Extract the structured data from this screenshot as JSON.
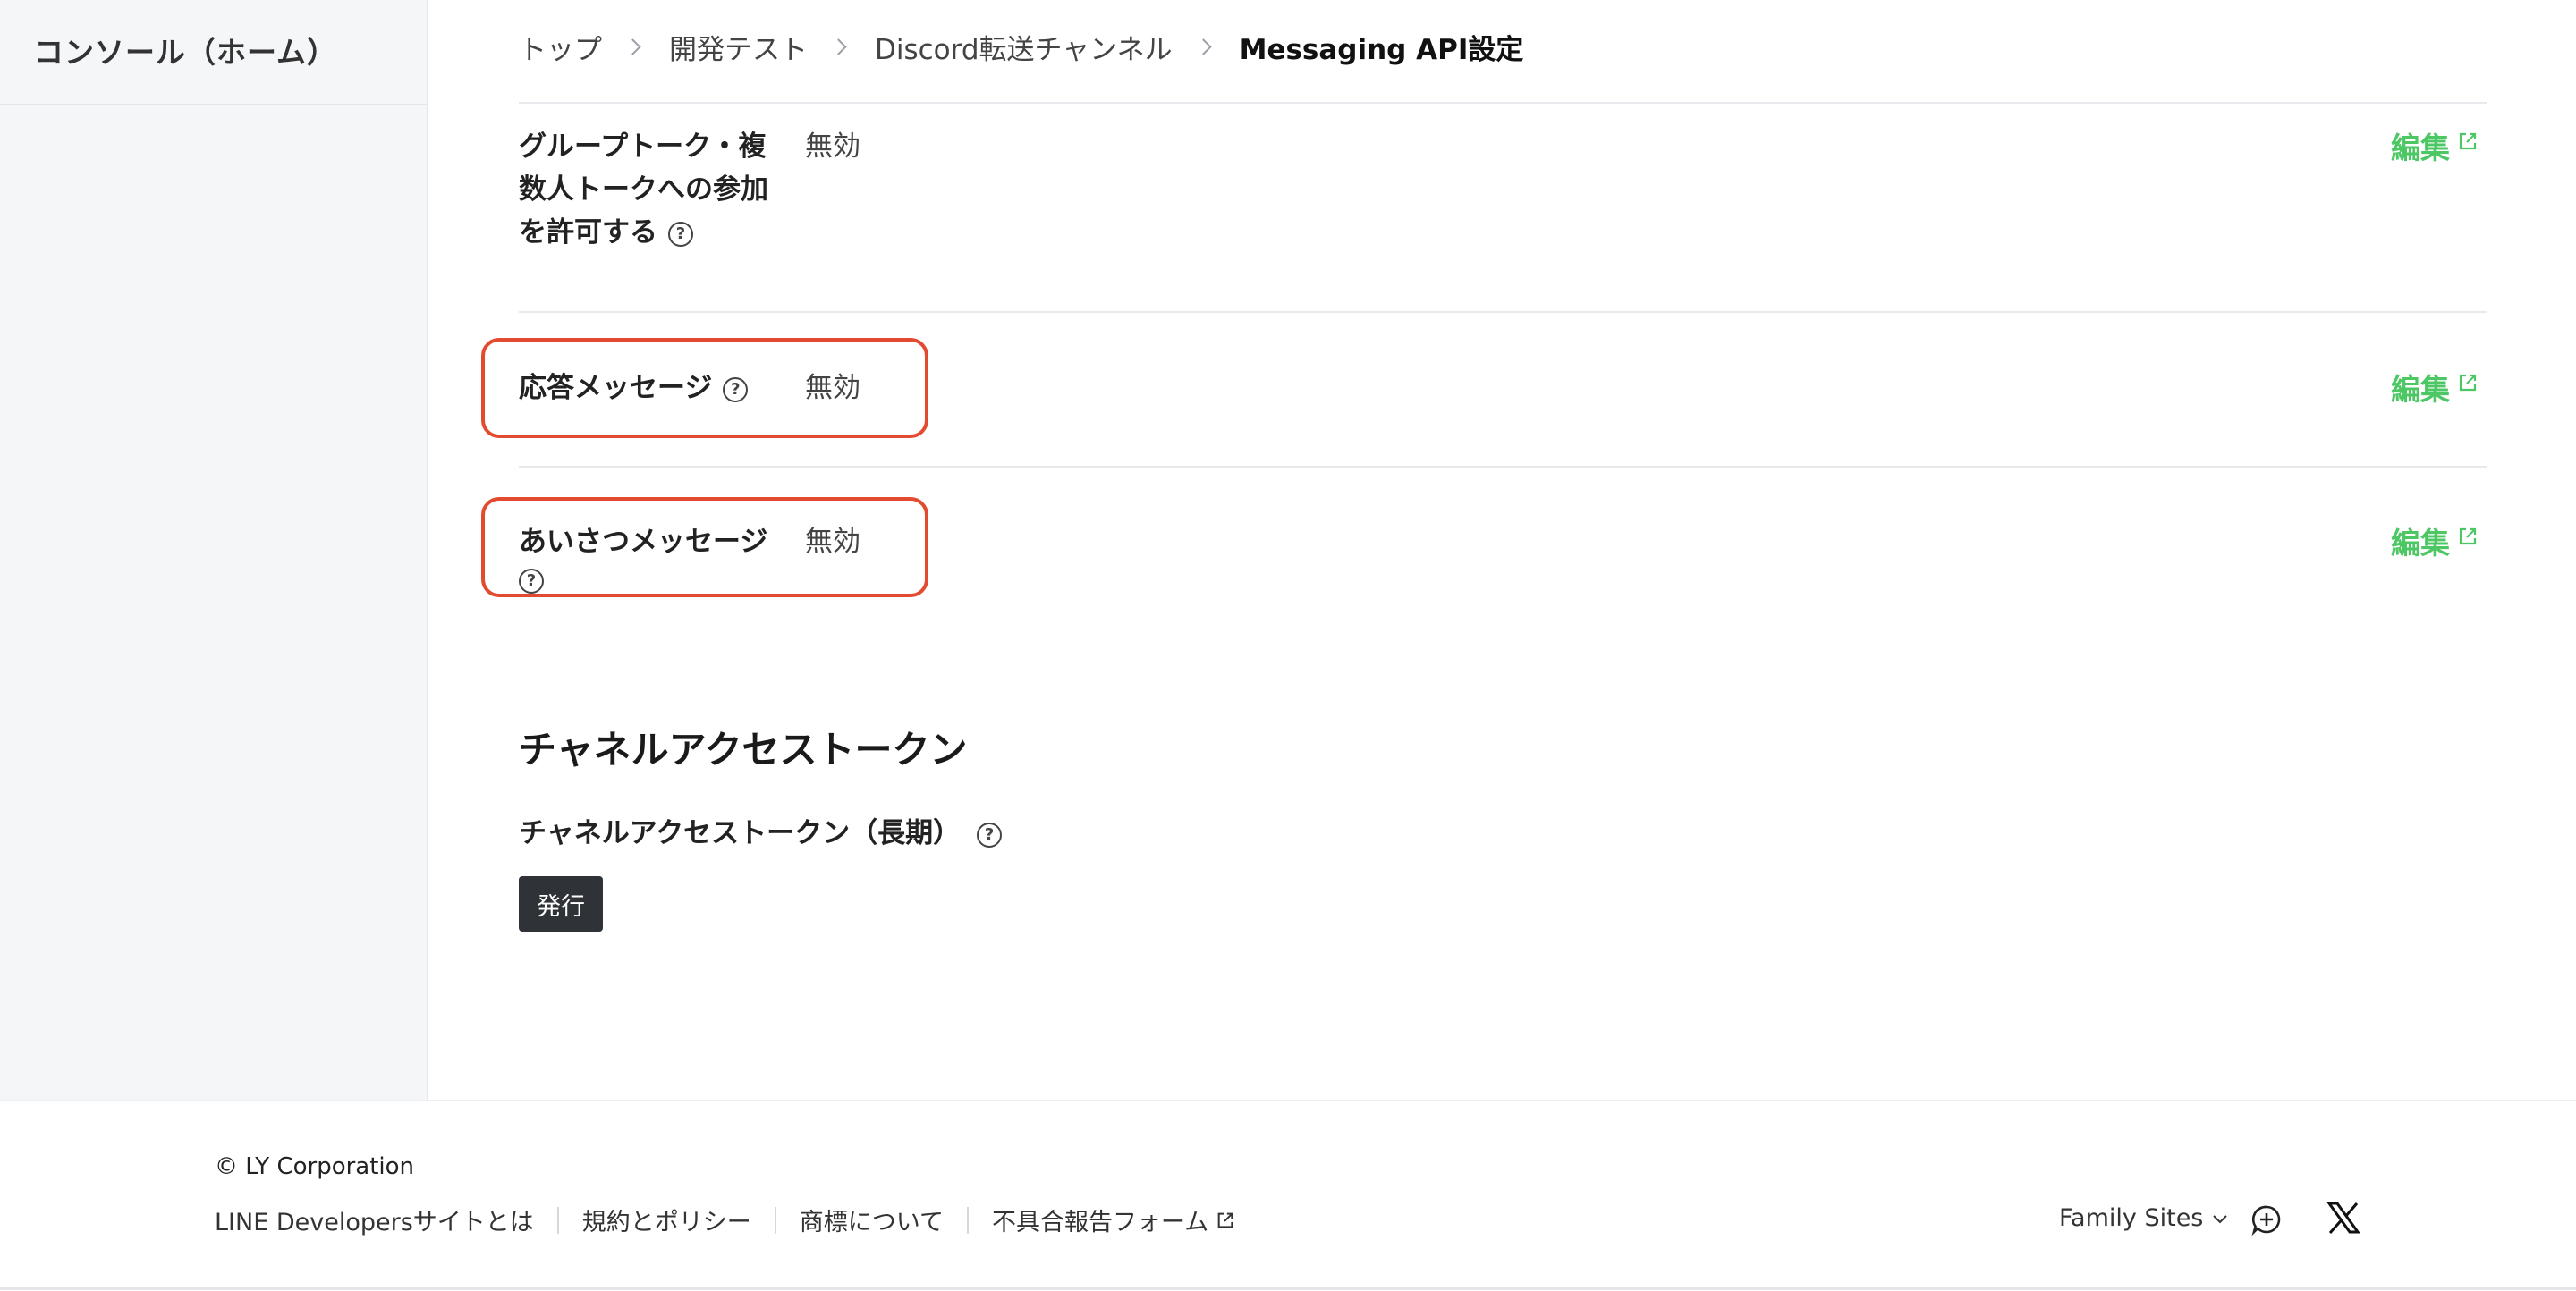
{
  "sidebar": {
    "title": "コンソール（ホーム）"
  },
  "breadcrumb": {
    "items": [
      "トップ",
      "開発テスト",
      "Discord転送チャンネル"
    ],
    "current": "Messaging API設定"
  },
  "settings": {
    "rows": [
      {
        "label_lines": [
          "グループトーク・複",
          "数人トークへの参加",
          "を許可する"
        ],
        "value": "無効",
        "edit_label": "編集"
      },
      {
        "label": "応答メッセージ",
        "value": "無効",
        "edit_label": "編集"
      },
      {
        "label": "あいさつメッセージ",
        "value": "無効",
        "edit_label": "編集"
      }
    ],
    "help_glyph": "?"
  },
  "token_section": {
    "title": "チャネルアクセストークン",
    "label": "チャネルアクセストークン（長期）",
    "issue_button": "発行"
  },
  "footer": {
    "copyright": "© LY Corporation",
    "links": [
      "LINE Developersサイトとは",
      "規約とポリシー",
      "商標について",
      "不具合報告フォーム"
    ],
    "family_sites": "Family Sites"
  },
  "colors": {
    "accent": "#4cc764",
    "highlight": "#e24b2f",
    "button_bg": "#2f3337"
  }
}
